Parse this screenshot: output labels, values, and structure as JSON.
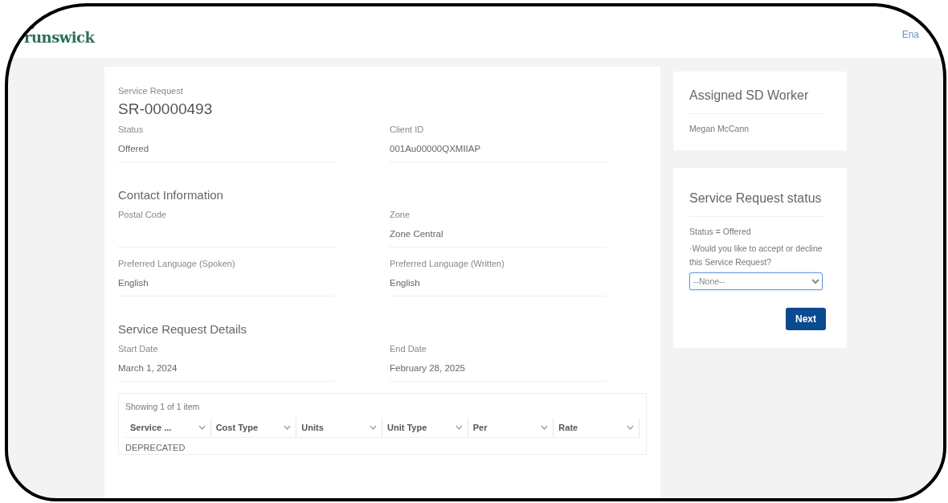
{
  "header": {
    "logo_text": "runswick",
    "link": "Ena"
  },
  "record": {
    "label": "Service Request",
    "number": "SR-00000493",
    "fields": [
      {
        "label": "Status",
        "value": "Offered"
      },
      {
        "label": "Client ID",
        "value": "001Au00000QXMIIAP"
      }
    ]
  },
  "sections": [
    {
      "title": "Contact Information",
      "fields": [
        {
          "label": "Postal Code"
        },
        {
          "label": "Zone",
          "value": "Zone Central"
        },
        {
          "label": "Preferred Language (Spoken)",
          "value": "English"
        },
        {
          "label": "Preferred Language (Written)",
          "value": "English"
        }
      ]
    },
    {
      "title": "Service Request Details",
      "fields": [
        {
          "label": "Start Date",
          "value": "March 1, 2024"
        },
        {
          "label": "End Date",
          "value": "February 28, 2025"
        }
      ]
    }
  ],
  "table": {
    "summary": "Showing 1 of 1 item",
    "columns": [
      "Service ...",
      "Cost Type",
      "Units",
      "Unit Type",
      "Per",
      "Rate"
    ],
    "rows": [
      [
        "DEPRECATED"
      ]
    ]
  },
  "worker_card": {
    "title": "Assigned SD Worker",
    "name": "Megan McCann"
  },
  "status_card": {
    "title": "Service Request status",
    "status_line": "Status = Offered",
    "question": "·Would you like to accept or decline this Service Request?",
    "select": {
      "value": "--None--"
    },
    "button": "Next"
  }
}
